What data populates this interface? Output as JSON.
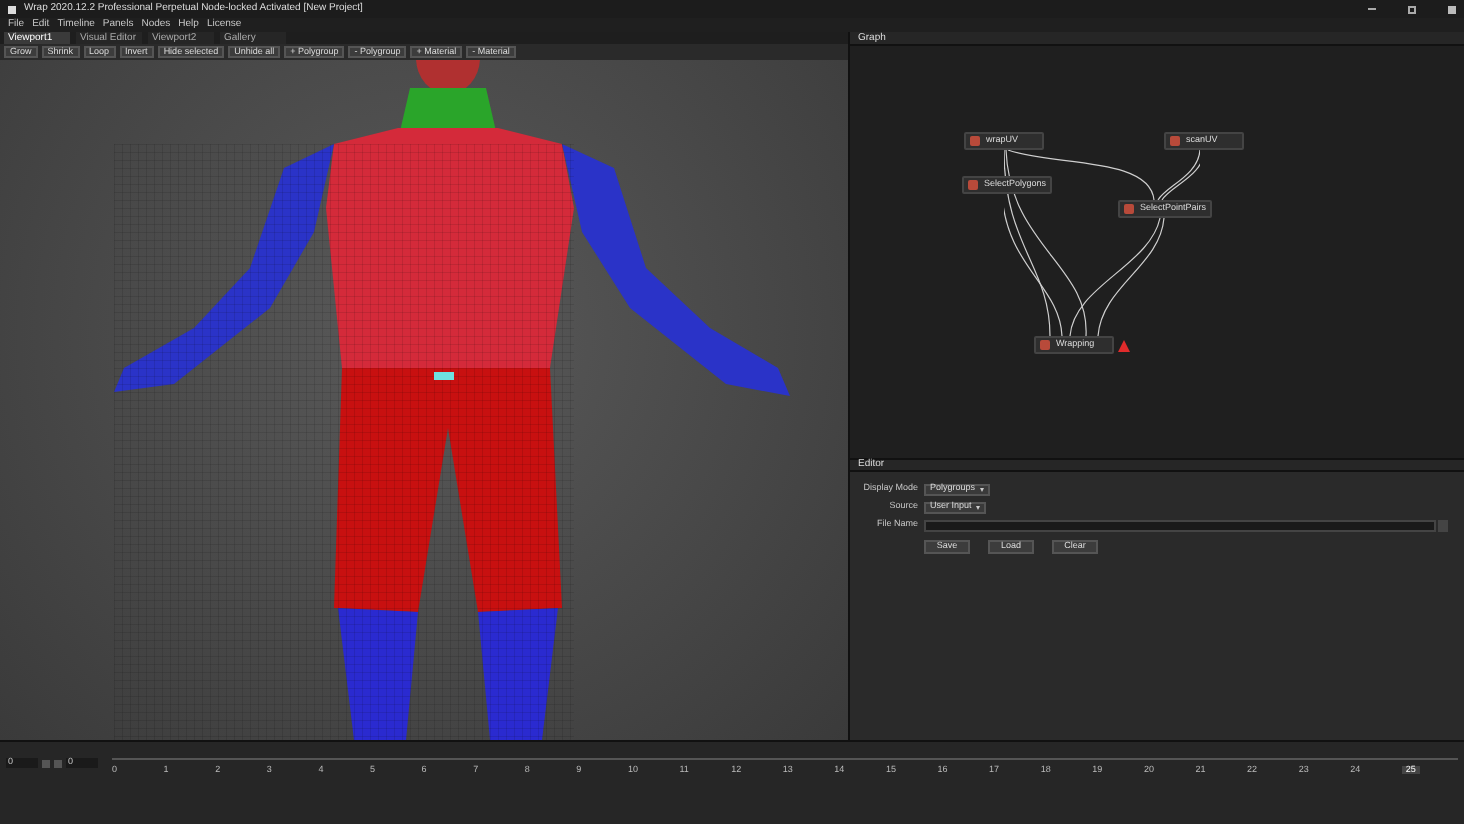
{
  "window": {
    "title": "Wrap 2020.12.2 Professional Perpetual Node-locked Activated [New Project]"
  },
  "menu": [
    "File",
    "Edit",
    "Timeline",
    "Panels",
    "Nodes",
    "Help",
    "License"
  ],
  "viewport_tabs": [
    {
      "label": "Viewport1",
      "selected": true
    },
    {
      "label": "Visual Editor",
      "selected": false
    },
    {
      "label": "Viewport2",
      "selected": false
    },
    {
      "label": "Gallery",
      "selected": false
    }
  ],
  "toolbar": [
    "Grow",
    "Shrink",
    "Loop",
    "Invert",
    "Hide selected",
    "Unhide all",
    "+ Polygroup",
    "- Polygroup",
    "+ Material",
    "- Material"
  ],
  "graph": {
    "title": "Graph",
    "nodes": [
      {
        "label": "wrapUV",
        "warning": false
      },
      {
        "label": "scanUV",
        "warning": false
      },
      {
        "label": "SelectPolygons",
        "warning": false
      },
      {
        "label": "SelectPointPairs",
        "warning": false
      },
      {
        "label": "Wrapping",
        "warning": true
      }
    ]
  },
  "editor": {
    "title": "Editor",
    "fields": [
      {
        "label": "Display Mode",
        "kind": "dropdown",
        "value": "Polygroups"
      },
      {
        "label": "Source",
        "kind": "dropdown",
        "value": "User Input"
      },
      {
        "label": "File Name",
        "kind": "text"
      }
    ],
    "buttons": [
      "Save",
      "Load",
      "Clear"
    ]
  },
  "timeline": {
    "start": "0",
    "end": "0",
    "ticks": [
      "0",
      "1",
      "2",
      "3",
      "4",
      "5",
      "6",
      "7",
      "8",
      "9",
      "10",
      "11",
      "12",
      "13",
      "14",
      "15",
      "16",
      "17",
      "18",
      "19",
      "20",
      "21",
      "22",
      "23",
      "24"
    ],
    "current": "25"
  }
}
